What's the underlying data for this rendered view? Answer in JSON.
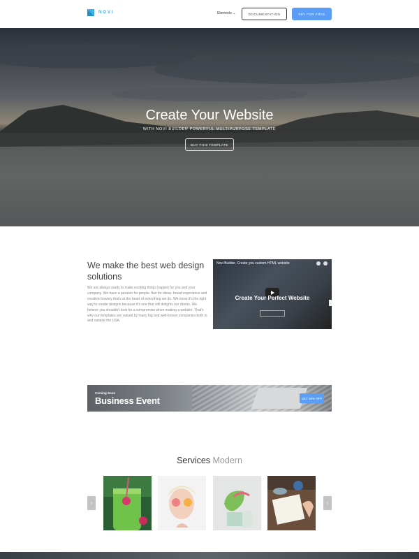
{
  "header": {
    "logo_text": "NOVI",
    "nav_elements": "Elements",
    "documentation_label": "DOCUMENTATION",
    "try_label": "TRY FOR FREE"
  },
  "hero": {
    "title": "Create Your Website",
    "subtitle": "WITH NOVI BUILDER POWERFUL MULTIPURPOSE TEMPLATE",
    "button_label": "BUY THIS TEMPLATE"
  },
  "about": {
    "title": "We make the best web design solutions",
    "text": "We are always ready to make exciting things happen for you and your company. We have a passion for people, flair for ideas, broad experience and creative bravery that's at the heart of everything we do. We know it's the right way to create designs because it's one that still delights our clients. We believe you shouldn't look for a compromise when making a website. That's why our templates are valued by many big and well-known companies both in and outside the USA.",
    "video": {
      "title": "Novi Builder. Create you custom HTML website",
      "headline": "Create Your Perfect Website"
    }
  },
  "banner": {
    "small": "Coming Soon",
    "big": "Business Event",
    "button_label": "GET 50% OFF"
  },
  "services": {
    "title": "Services",
    "title_muted": "Modern",
    "prev_arrow": "‹",
    "next_arrow": "›"
  },
  "colors": {
    "accent": "#5b9cf4",
    "logo": "#37b0e8"
  },
  "icons": [
    "logo-mark-icon",
    "chevron-down-icon",
    "play-icon",
    "clock-icon",
    "share-icon",
    "arrow-left-icon",
    "arrow-right-icon"
  ]
}
